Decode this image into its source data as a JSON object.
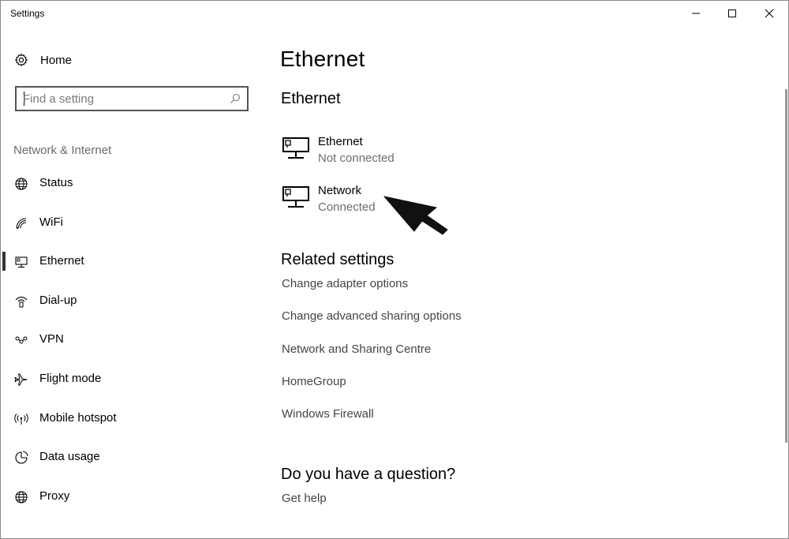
{
  "window": {
    "title": "Settings"
  },
  "sidebar": {
    "home_label": "Home",
    "search_placeholder": "Find a setting",
    "section_label": "Network & Internet",
    "items": [
      {
        "label": "Status",
        "icon": "globe-icon"
      },
      {
        "label": "WiFi",
        "icon": "wifi-icon"
      },
      {
        "label": "Ethernet",
        "icon": "ethernet-icon",
        "active": true
      },
      {
        "label": "Dial-up",
        "icon": "dialup-icon"
      },
      {
        "label": "VPN",
        "icon": "vpn-icon"
      },
      {
        "label": "Flight mode",
        "icon": "airplane-icon"
      },
      {
        "label": "Mobile hotspot",
        "icon": "hotspot-icon"
      },
      {
        "label": "Data usage",
        "icon": "data-usage-icon"
      },
      {
        "label": "Proxy",
        "icon": "globe-icon"
      }
    ]
  },
  "main": {
    "title": "Ethernet",
    "subtitle": "Ethernet",
    "networks": [
      {
        "name": "Ethernet",
        "status": "Not connected"
      },
      {
        "name": "Network",
        "status": "Connected"
      }
    ],
    "related_title": "Related settings",
    "related_links": [
      "Change adapter options",
      "Change advanced sharing options",
      "Network and Sharing Centre",
      "HomeGroup",
      "Windows Firewall"
    ],
    "question_title": "Do you have a question?",
    "help_link": "Get help"
  },
  "colors": {
    "accent_bar": "#333333",
    "secondary_text": "#6e6e6e",
    "link_text": "#444444"
  }
}
